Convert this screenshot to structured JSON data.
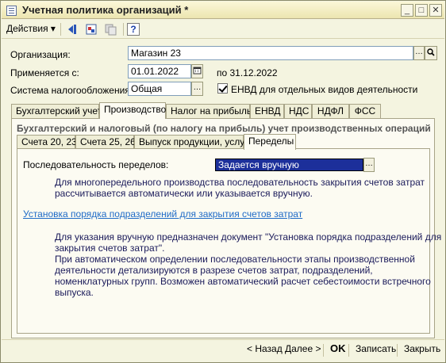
{
  "window": {
    "title": "Учетная политика организаций *"
  },
  "toolbar": {
    "actions_label": "Действия",
    "help_label": "?"
  },
  "form": {
    "org_label": "Организация:",
    "org_value": "Магазин 23",
    "applies_label": "Применяется с:",
    "applies_value": "01.01.2022",
    "until_text": "по 31.12.2022",
    "tax_label": "Система налогообложения:",
    "tax_value": "Общая",
    "envd_label": "ЕНВД для отдельных видов деятельности"
  },
  "tabs": [
    {
      "label": "Бухгалтерский учет"
    },
    {
      "label": "Производство"
    },
    {
      "label": "Налог на прибыль"
    },
    {
      "label": "ЕНВД"
    },
    {
      "label": "НДС"
    },
    {
      "label": "НДФЛ"
    },
    {
      "label": "ФСС"
    }
  ],
  "production": {
    "group_title": "Бухгалтерский и налоговый (по налогу на прибыль) учет производственных операций",
    "subtabs": [
      {
        "label": "Счета 20, 23"
      },
      {
        "label": "Счета 25, 26"
      },
      {
        "label": "Выпуск продукции, услуг"
      },
      {
        "label": "Переделы"
      }
    ],
    "sequence_label": "Последовательность переделов:",
    "sequence_value": "Задается вручную",
    "help1_line1": "Для многопередельного производства последовательность закрытия счетов затрат",
    "help1_line2": "рассчитывается автоматически или указывается вручную.",
    "link_text": "Установка порядка подразделений для закрытия счетов затрат",
    "help2_line1": "Для указания вручную предназначен документ \"Установка порядка подразделений для",
    "help2_line2": "закрытия счетов затрат\".",
    "help2_line3": "При автоматическом определении последовательности этапы производственной",
    "help2_line4": "деятельности детализируются в разрезе счетов затрат, подразделений,",
    "help2_line5": "номенклатурных групп. Возможен автоматический расчет себестоимости встречного",
    "help2_line6": "выпуска."
  },
  "footer": {
    "back_label": "< Назад",
    "next_label": "Далее >",
    "ok_label": "OK",
    "save_label": "Записать",
    "close_label": "Закрыть"
  }
}
